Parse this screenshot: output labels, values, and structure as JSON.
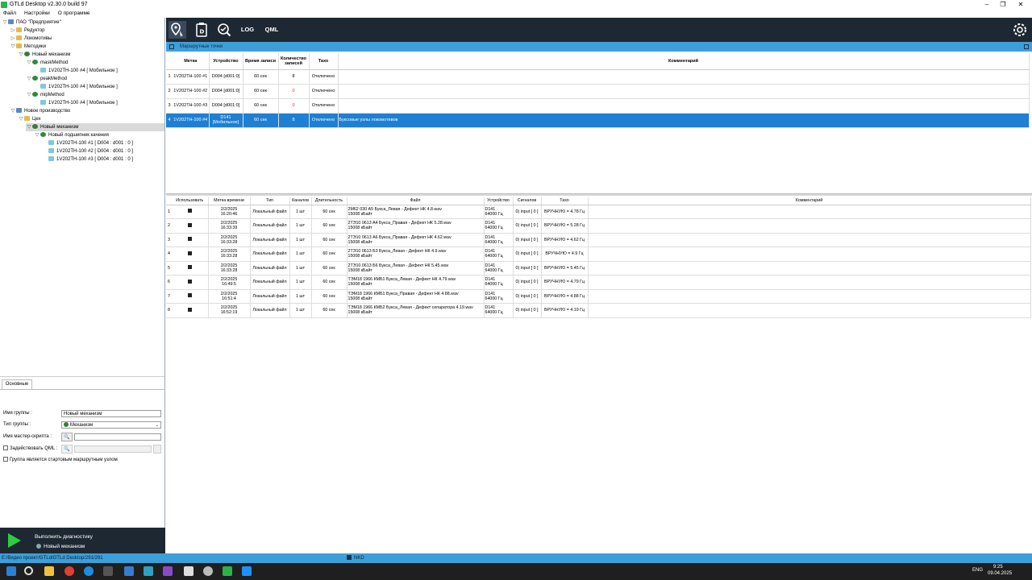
{
  "window": {
    "title": "GTLd Desktop v2.30.0 build 97",
    "minimize": "–",
    "maximize": "❐",
    "close": "✕"
  },
  "menu": [
    "Файл",
    "Настройки",
    "О программе"
  ],
  "tree": [
    {
      "label": "ПАО \"Предприятие\"",
      "level": 0,
      "exp": "▽",
      "icon": "building"
    },
    {
      "label": "Редуктор",
      "level": 1,
      "exp": "▷",
      "icon": "folder"
    },
    {
      "label": "Локомотивы",
      "level": 1,
      "exp": "▷",
      "icon": "folder"
    },
    {
      "label": "Методики",
      "level": 1,
      "exp": "▽",
      "icon": "folder"
    },
    {
      "label": "Новый механизм",
      "level": 2,
      "exp": "▽",
      "icon": "gear"
    },
    {
      "label": "maskMethod",
      "level": 3,
      "exp": "▽",
      "icon": "method"
    },
    {
      "label": "1V202TH-100 #4 [ Мобильное ]",
      "level": 4,
      "exp": "",
      "icon": "sensor"
    },
    {
      "label": "peakMethod",
      "level": 3,
      "exp": "▽",
      "icon": "method"
    },
    {
      "label": "1V202TH-100 #4 [ Мобильное ]",
      "level": 4,
      "exp": "",
      "icon": "sensor"
    },
    {
      "label": "mipMethod",
      "level": 3,
      "exp": "▽",
      "icon": "method"
    },
    {
      "label": "1V202TH-100 #4 [ Мобильное ]",
      "level": 4,
      "exp": "",
      "icon": "sensor"
    },
    {
      "label": "Новое производство",
      "level": 1,
      "exp": "▽",
      "icon": "building"
    },
    {
      "label": "Цех",
      "level": 2,
      "exp": "▽",
      "icon": "folder"
    },
    {
      "label": "Новый механизм",
      "level": 3,
      "exp": "▽",
      "icon": "gear",
      "selected": true
    },
    {
      "label": "Новый подшипник качения",
      "level": 4,
      "exp": "▽",
      "icon": "method"
    },
    {
      "label": "1V202TH-100 #1 [ D004 : d001 : 0 ]",
      "level": 5,
      "exp": "",
      "icon": "sensor"
    },
    {
      "label": "1V202TH-100 #2 [ D004 : d001 : 0 ]",
      "level": 5,
      "exp": "",
      "icon": "sensor"
    },
    {
      "label": "1V202TH-100 #3 [ D004 : d001 : 0 ]",
      "level": 5,
      "exp": "",
      "icon": "sensor"
    }
  ],
  "props": {
    "tab": "Основные",
    "group_name_label": "Имя группы :",
    "group_name_value": "Новый механизм",
    "group_type_label": "Тип группы :",
    "group_type_value": "Механизм",
    "master_script_label": "Имя мастер-скрипта :",
    "qml_label": "Задействовать QML :",
    "start_node_label": "Группа является стартовым маршрутным узлом"
  },
  "run": {
    "line1": "Выполнить диагностику",
    "line2": "Новый механизм"
  },
  "toolbar": {
    "log": "LOG",
    "qml": "QML"
  },
  "section": {
    "title": "Маршрутные точки"
  },
  "routes": {
    "headers": [
      "Метка",
      "Устройство",
      "Время записи",
      "Количество записей",
      "Тахо",
      "Комментарий"
    ],
    "rows": [
      {
        "n": "1",
        "mark": "1V202TH-100 #1",
        "device": "D004 [d001:0]",
        "time": "60 сек",
        "count": "8",
        "tacho": "Отключено",
        "comment": "",
        "red": false
      },
      {
        "n": "2",
        "mark": "1V202TH-100 #2",
        "device": "D004 [d001:0]",
        "time": "60 сек",
        "count": "0",
        "tacho": "Отключено",
        "comment": "",
        "red": true
      },
      {
        "n": "3",
        "mark": "1V202TH-100 #3",
        "device": "D004 [d001:0]",
        "time": "60 сек",
        "count": "0",
        "tacho": "Отключено",
        "comment": "",
        "red": true
      },
      {
        "n": "4",
        "mark": "1V202TH-100 #4",
        "device": "D141 [Мобильное]",
        "time": "60 сек",
        "count": "8",
        "tacho": "Отключено",
        "comment": "Буксовые узлы локомотивов",
        "red": false,
        "selected": true
      }
    ]
  },
  "records": {
    "headers": [
      "Использовать",
      "Метка времени",
      "Тип",
      "Каналов",
      "Длительность",
      "Файл",
      "Устройство",
      "Сигналов",
      "Тахо",
      "Комментарий"
    ],
    "rows": [
      {
        "n": "1",
        "date": "2/2/2025",
        "time": "16:20:46",
        "type": "Локальный файл",
        "ch": "1 шт",
        "dur": "60 сек",
        "file1": "2М62 030 А5 Букса_Левая - Дефект НК 4.8.wav",
        "file2": "15008 кБайт",
        "dev1": "D141",
        "dev2": "64000 Гц",
        "sig": "0) input [ 0 ]",
        "tacho": "ВРУЧНУЮ = 4.78 Гц"
      },
      {
        "n": "2",
        "date": "2/2/2025",
        "time": "16:33:39",
        "type": "Локальный файл",
        "ch": "1 шт",
        "dur": "60 сек",
        "file1": "2ТЭ10 0613 А4 Букса_Правая - Дефект НК 5.28.wav",
        "file2": "15008 кБайт",
        "dev1": "D141",
        "dev2": "64000 Гц",
        "sig": "0) input [ 0 ]",
        "tacho": "ВРУЧНУЮ = 5.28 Гц"
      },
      {
        "n": "3",
        "date": "2/2/2025",
        "time": "16:33:28",
        "type": "Локальный файл",
        "ch": "1 шт",
        "dur": "60 сек",
        "file1": "2ТЭ10 0613 А6 Букса_Правая - Дефект НК 4.62.wav",
        "file2": "15008 кБайт",
        "dev1": "D141",
        "dev2": "64000 Гц",
        "sig": "0) input [ 0 ]",
        "tacho": "ВРУЧНУЮ = 4.62 Гц"
      },
      {
        "n": "4",
        "date": "2/2/2025",
        "time": "16:33:28",
        "type": "Локальный файл",
        "ch": "1 шт",
        "dur": "60 сек",
        "file1": "2ТЭ10 0613 Б3 Букса_Левая - Дефект НК 4.9.wav",
        "file2": "15008 кБайт",
        "dev1": "D141",
        "dev2": "64000 Гц",
        "sig": "0) input [ 0 ]",
        "tacho": "ВРУЧНУЮ = 4.9 Гц"
      },
      {
        "n": "5",
        "date": "2/2/2025",
        "time": "16:33:28",
        "type": "Локальный файл",
        "ch": "1 шт",
        "dur": "60 сек",
        "file1": "2ТЭ10 0613 Б6 Букса_Левая - Дефект НК 5.45.wav",
        "file2": "15008 кБайт",
        "dev1": "D141",
        "dev2": "64000 Гц",
        "sig": "0) input [ 0 ]",
        "tacho": "ВРУЧНУЮ = 5.45 Гц"
      },
      {
        "n": "6",
        "date": "2/2/2025",
        "time": "16:49:5",
        "type": "Локальный файл",
        "ch": "1 шт",
        "dur": "60 сек",
        "file1": "ТЭМ18 1966 КМБ1 Букса_Левая - Дефект НК 4.79.wav",
        "file2": "15008 кБайт",
        "dev1": "D141",
        "dev2": "64000 Гц",
        "sig": "0) input [ 0 ]",
        "tacho": "ВРУЧНУЮ = 4.79 Гц"
      },
      {
        "n": "7",
        "date": "2/2/2025",
        "time": "16:51:4",
        "type": "Локальный файл",
        "ch": "1 шт",
        "dur": "60 сек",
        "file1": "ТЭМ18 1966 КМБ1 Букса_Правая - Дефект НК 4.88.wav",
        "file2": "15008 кБайт",
        "dev1": "D141",
        "dev2": "64000 Гц",
        "sig": "0) input [ 0 ]",
        "tacho": "ВРУЧНУЮ = 4.88 Гц"
      },
      {
        "n": "8",
        "date": "2/2/2025",
        "time": "16:52:19",
        "type": "Локальный файл",
        "ch": "1 шт",
        "dur": "60 сек",
        "file1": "ТЭМ18 1966 КМБ2 Букса_Левая - Дефект сепаратора 4.19.wav",
        "file2": "15008 кБайт",
        "dev1": "D141",
        "dev2": "64000 Гц",
        "sig": "0) input [ 0 ]",
        "tacho": "ВРУЧНУЮ = 4.19 Гц"
      }
    ]
  },
  "status": {
    "path": "E:/Видео проект/GTLd/GTLd Desktop/291/291",
    "mid": "NKD"
  },
  "tray": {
    "lang": "ENG",
    "time": "9:25",
    "date": "09.04.2025"
  },
  "colors": {
    "accent": "#3d9fd9",
    "selection": "#1e7fd3",
    "toolbar": "#1e2832",
    "run": "#2ecc40"
  }
}
